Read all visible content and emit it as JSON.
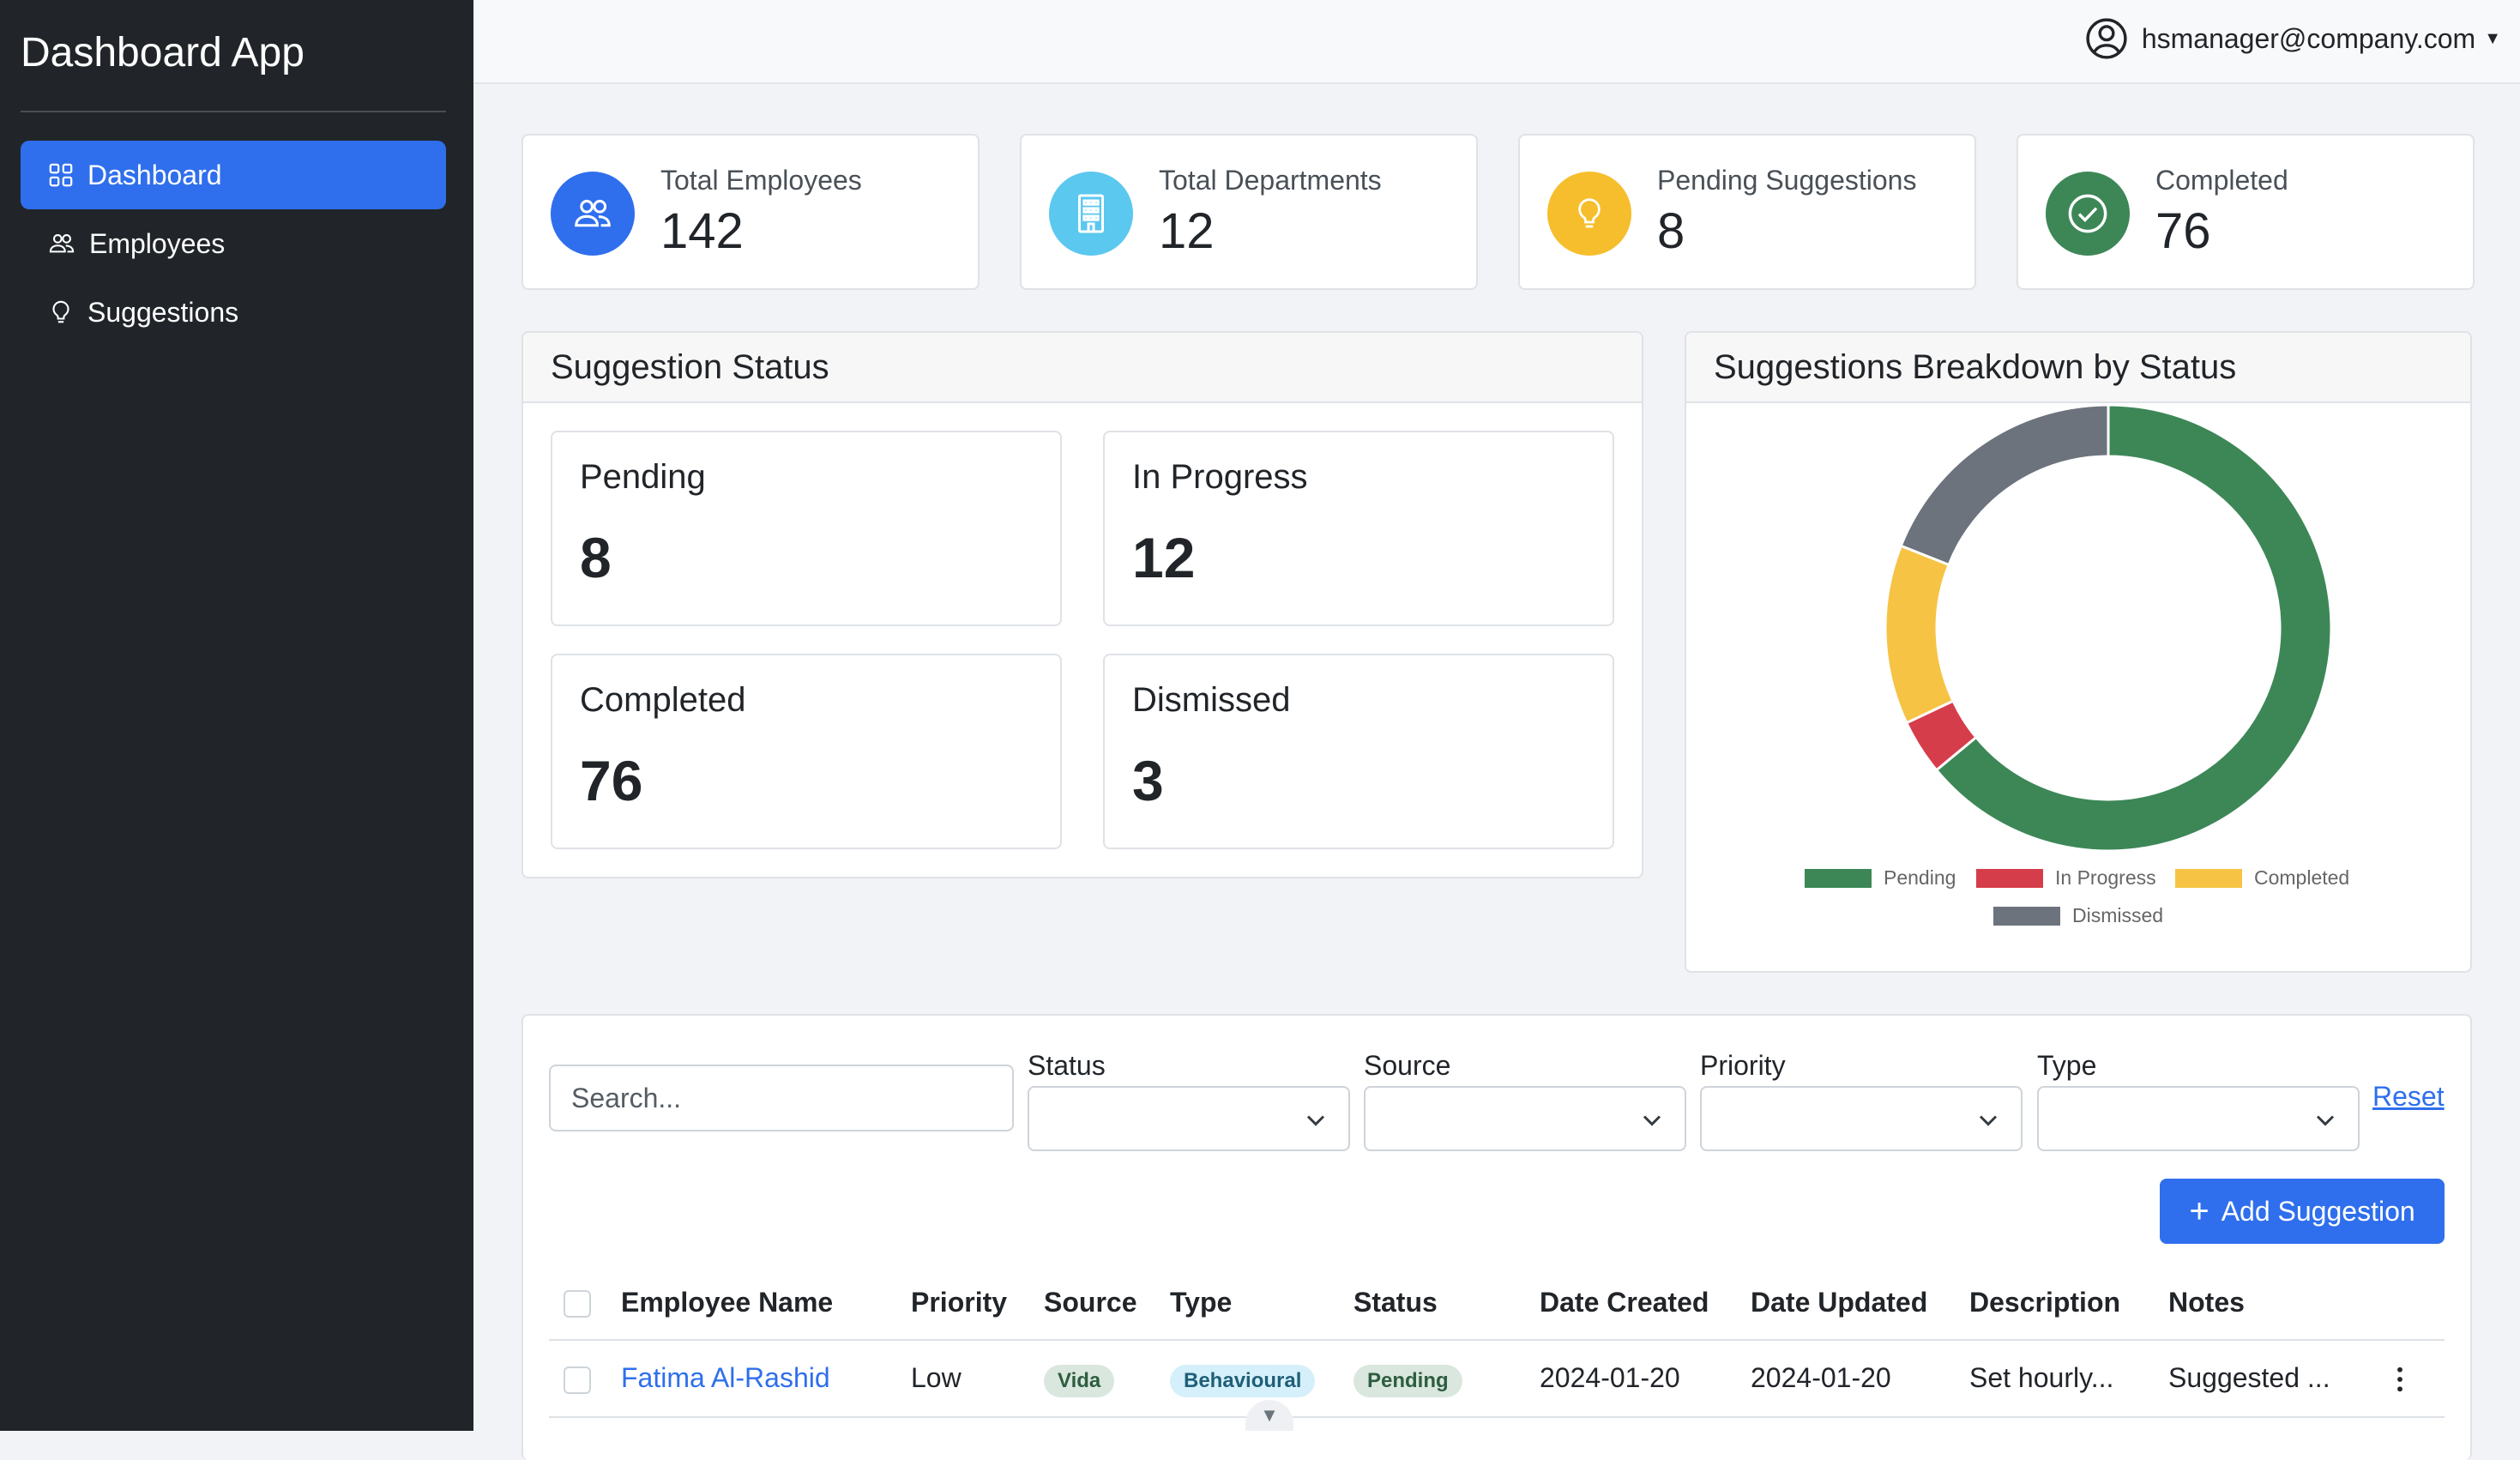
{
  "app": {
    "title": "Dashboard App"
  },
  "sidebar": {
    "items": [
      {
        "label": "Dashboard",
        "icon": "grid-icon",
        "active": true
      },
      {
        "label": "Employees",
        "icon": "people-icon",
        "active": false
      },
      {
        "label": "Suggestions",
        "icon": "lightbulb-icon",
        "active": false
      }
    ]
  },
  "header": {
    "user_email": "hsmanager@company.com",
    "icon": "person-circle-icon"
  },
  "stats": [
    {
      "label": "Total Employees",
      "value": "142",
      "icon": "people-icon",
      "color": "#2f6fed"
    },
    {
      "label": "Total Departments",
      "value": "12",
      "icon": "building-icon",
      "color": "#5bc8ef"
    },
    {
      "label": "Pending Suggestions",
      "value": "8",
      "icon": "lightbulb-icon",
      "color": "#f6be2c"
    },
    {
      "label": "Completed",
      "value": "76",
      "icon": "check-circle-icon",
      "color": "#3d8757"
    }
  ],
  "suggestion_status": {
    "title": "Suggestion Status",
    "items": [
      {
        "label": "Pending",
        "value": "8"
      },
      {
        "label": "In Progress",
        "value": "12"
      },
      {
        "label": "Completed",
        "value": "76"
      },
      {
        "label": "Dismissed",
        "value": "3"
      }
    ]
  },
  "breakdown": {
    "title": "Suggestions Breakdown by Status"
  },
  "chart_data": {
    "type": "pie",
    "style": "doughnut",
    "categories": [
      "Pending",
      "In Progress",
      "Completed",
      "Dismissed"
    ],
    "values": [
      64,
      4,
      13,
      19
    ],
    "colors": [
      "#3d8757",
      "#d63d4a",
      "#f6c344",
      "#6c737c"
    ],
    "legend": "bottom"
  },
  "filters": {
    "search_placeholder": "Search...",
    "status_label": "Status",
    "source_label": "Source",
    "priority_label": "Priority",
    "type_label": "Type",
    "reset_label": "Reset",
    "add_label": "Add Suggestion"
  },
  "table": {
    "columns": [
      "Employee Name",
      "Priority",
      "Source",
      "Type",
      "Status",
      "Date Created",
      "Date Updated",
      "Description",
      "Notes"
    ],
    "rows": [
      {
        "employee": "Fatima Al-Rashid",
        "priority": "Low",
        "source": "Vida",
        "type": "Behavioural",
        "status": "Pending",
        "date_created": "2024-01-20",
        "date_updated": "2024-01-20",
        "description": "Set hourly...",
        "notes": "Suggested ..."
      }
    ]
  },
  "colors": {
    "primary": "#2f6fed",
    "sidebar_bg": "#212529"
  }
}
